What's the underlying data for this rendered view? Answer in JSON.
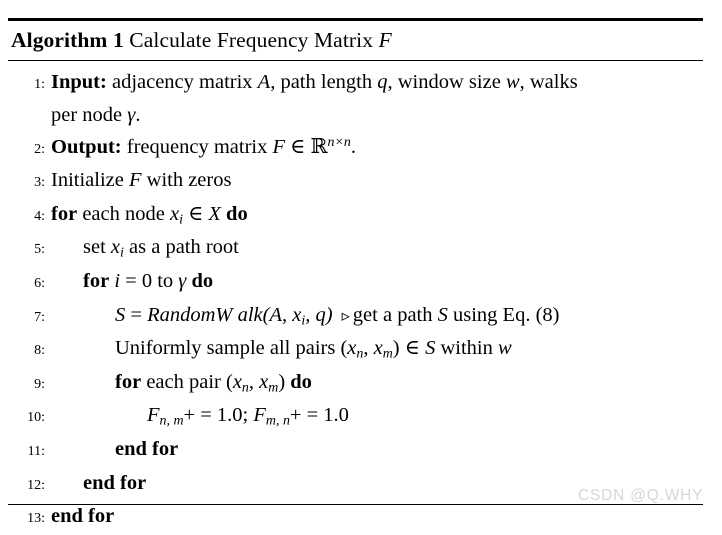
{
  "algorithm": {
    "title_keyword": "Algorithm",
    "title_number": "1",
    "title_text": "Calculate Frequency Matrix",
    "title_symbol": "F",
    "lines": [
      {
        "number": "1:",
        "indent": 0,
        "label": "Input:",
        "text_a": "adjacency matrix",
        "var_a": "A",
        "text_b": ", path length",
        "var_b": "q",
        "text_c": ", window size",
        "var_c": "w",
        "text_d": ", walks",
        "continuation_text": "per node",
        "continuation_var": "γ",
        "continuation_tail": "."
      },
      {
        "number": "2:",
        "indent": 0,
        "label": "Output:",
        "text_a": "frequency matrix",
        "var_a": "F",
        "text_b": "∈",
        "field": "ℝ",
        "exponent": "n×n",
        "text_c": "."
      },
      {
        "number": "3:",
        "indent": 0,
        "text_a": "Initialize",
        "var_a": "F",
        "text_b": "with zeros"
      },
      {
        "number": "4:",
        "indent": 0,
        "kw_a": "for",
        "text_a": "each node",
        "var_a": "x",
        "sub_a": "i",
        "text_b": "∈",
        "var_b": "X",
        "kw_b": "do"
      },
      {
        "number": "5:",
        "indent": 1,
        "text_a": "set",
        "var_a": "x",
        "sub_a": "i",
        "text_b": "as a path root"
      },
      {
        "number": "6:",
        "indent": 1,
        "kw_a": "for",
        "var_a": "i",
        "text_a": "= 0 to",
        "var_b": "γ",
        "kw_b": "do"
      },
      {
        "number": "7:",
        "indent": 2,
        "var_a": "S",
        "text_a": "=",
        "func": "RandomW alk",
        "args_open": "(",
        "arg_a": "A",
        "arg_sep1": ",",
        "arg_b": "x",
        "arg_b_sub": "i",
        "arg_sep2": ",",
        "arg_c": "q",
        "args_close": ")",
        "comment_marker": "▹",
        "comment_a": "get a path",
        "comment_var": "S",
        "comment_b": "using Eq. (8)"
      },
      {
        "number": "8:",
        "indent": 2,
        "text_a": "Uniformly sample all pairs (",
        "var_a": "x",
        "sub_a": "n",
        "text_b": ",",
        "var_b": "x",
        "sub_b": "m",
        "text_c": ") ∈",
        "var_c": "S",
        "text_d": "within",
        "var_d": "w"
      },
      {
        "number": "9:",
        "indent": 2,
        "kw_a": "for",
        "text_a": "each pair (",
        "var_a": "x",
        "sub_a": "n",
        "text_b": ",",
        "var_b": "x",
        "sub_b": "m",
        "text_c": ")",
        "kw_b": "do"
      },
      {
        "number": "10:",
        "indent": 3,
        "var_a": "F",
        "sub_a": "n, m",
        "text_a": "+ = 1.0;",
        "var_b": "F",
        "sub_b": "m, n",
        "text_b": "+ = 1.0"
      },
      {
        "number": "11:",
        "indent": 2,
        "kw_a": "end for"
      },
      {
        "number": "12:",
        "indent": 1,
        "kw_a": "end for"
      },
      {
        "number": "13:",
        "indent": 0,
        "kw_a": "end for"
      }
    ]
  },
  "watermark": {
    "text": "CSDN @Q.WHY"
  }
}
